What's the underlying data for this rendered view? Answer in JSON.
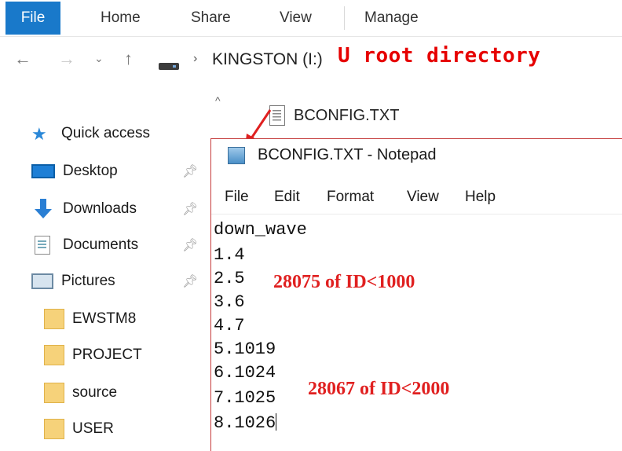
{
  "ribbon": {
    "file_tab": "File",
    "tabs": [
      "Home",
      "Share",
      "View",
      "Manage"
    ]
  },
  "address": {
    "back_icon": "arrow-left-icon",
    "forward_icon": "arrow-right-icon",
    "recent_icon": "chevron-down-icon",
    "up_icon": "arrow-up-icon",
    "path": "KINGSTON (I:)",
    "annotation": "U root directory"
  },
  "nav_pane": {
    "quick_access": "Quick access",
    "items": [
      {
        "label": "Desktop",
        "icon": "desktop-icon",
        "pinned": true
      },
      {
        "label": "Downloads",
        "icon": "downloads-icon",
        "pinned": true
      },
      {
        "label": "Documents",
        "icon": "documents-icon",
        "pinned": true
      },
      {
        "label": "Pictures",
        "icon": "pictures-icon",
        "pinned": true
      },
      {
        "label": "EWSTM8",
        "icon": "folder-icon",
        "pinned": false
      },
      {
        "label": "PROJECT",
        "icon": "folder-icon",
        "pinned": false
      },
      {
        "label": "source",
        "icon": "folder-icon",
        "pinned": false
      },
      {
        "label": "USER",
        "icon": "folder-icon",
        "pinned": false
      }
    ]
  },
  "files": [
    {
      "name": "BCONFIG.TXT",
      "icon": "text-file-icon"
    }
  ],
  "notepad": {
    "title": "BCONFIG.TXT - Notepad",
    "menu": [
      "File",
      "Edit",
      "Format",
      "View",
      "Help"
    ],
    "lines": [
      "down_wave",
      "1.4",
      "2.5",
      "3.6",
      "4.7",
      "5.1019",
      "6.1024",
      "7.1025",
      "8.1026"
    ]
  },
  "annotations": {
    "group1": "28075 of ID<1000",
    "group2": "28067 of ID<2000",
    "color": "#e02020"
  },
  "colors": {
    "file_tab_bg": "#1979ca",
    "annotation_red": "#e60000"
  }
}
